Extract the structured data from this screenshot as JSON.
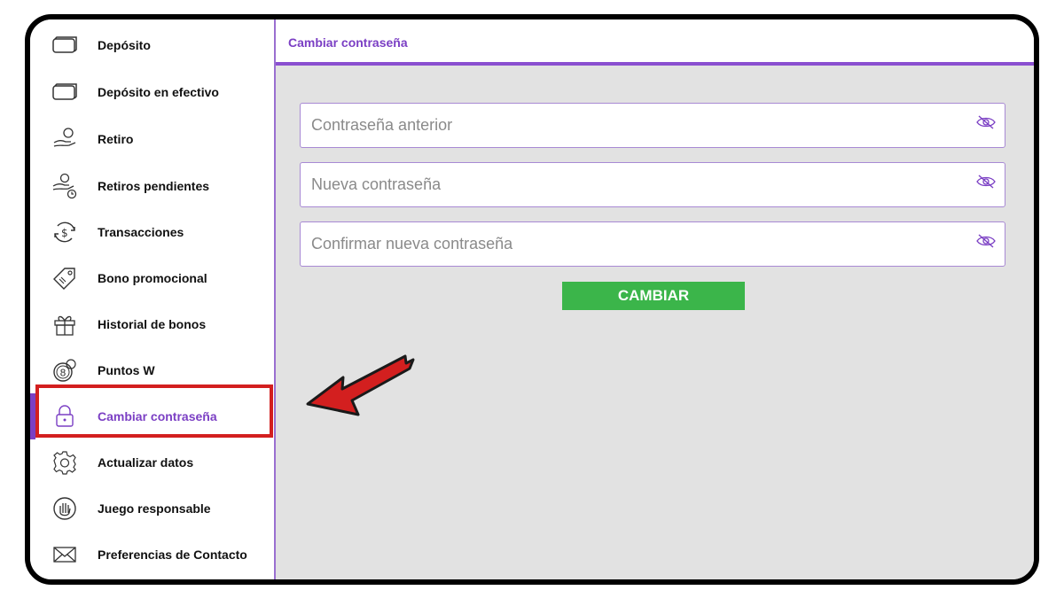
{
  "sidebar": {
    "items": [
      {
        "label": "Depósito",
        "icon": "card-icon"
      },
      {
        "label": "Depósito en efectivo",
        "icon": "card-icon"
      },
      {
        "label": "Retiro",
        "icon": "hand-coin-icon"
      },
      {
        "label": "Retiros pendientes",
        "icon": "hand-coin-clock-icon"
      },
      {
        "label": "Transacciones",
        "icon": "dollar-cycle-icon"
      },
      {
        "label": "Bono promocional",
        "icon": "tag-icon"
      },
      {
        "label": "Historial de bonos",
        "icon": "gift-icon"
      },
      {
        "label": "Puntos W",
        "icon": "coin-8-icon"
      },
      {
        "label": "Cambiar contraseña",
        "icon": "lock-icon",
        "active": true
      },
      {
        "label": "Actualizar datos",
        "icon": "gear-icon"
      },
      {
        "label": "Juego responsable",
        "icon": "hand-stop-icon"
      },
      {
        "label": "Preferencias de Contacto",
        "icon": "envelope-icon"
      }
    ]
  },
  "main": {
    "title": "Cambiar contraseña",
    "fields": [
      {
        "placeholder": "Contraseña anterior",
        "value": ""
      },
      {
        "placeholder": "Nueva contraseña",
        "value": ""
      },
      {
        "placeholder": "Confirmar nueva contraseña",
        "value": ""
      }
    ],
    "submit_label": "CAMBIAR"
  },
  "colors": {
    "accent": "#7b3fc4",
    "highlight": "#d31f1f",
    "submit": "#3bb54a",
    "content_bg": "#e2e2e2"
  }
}
